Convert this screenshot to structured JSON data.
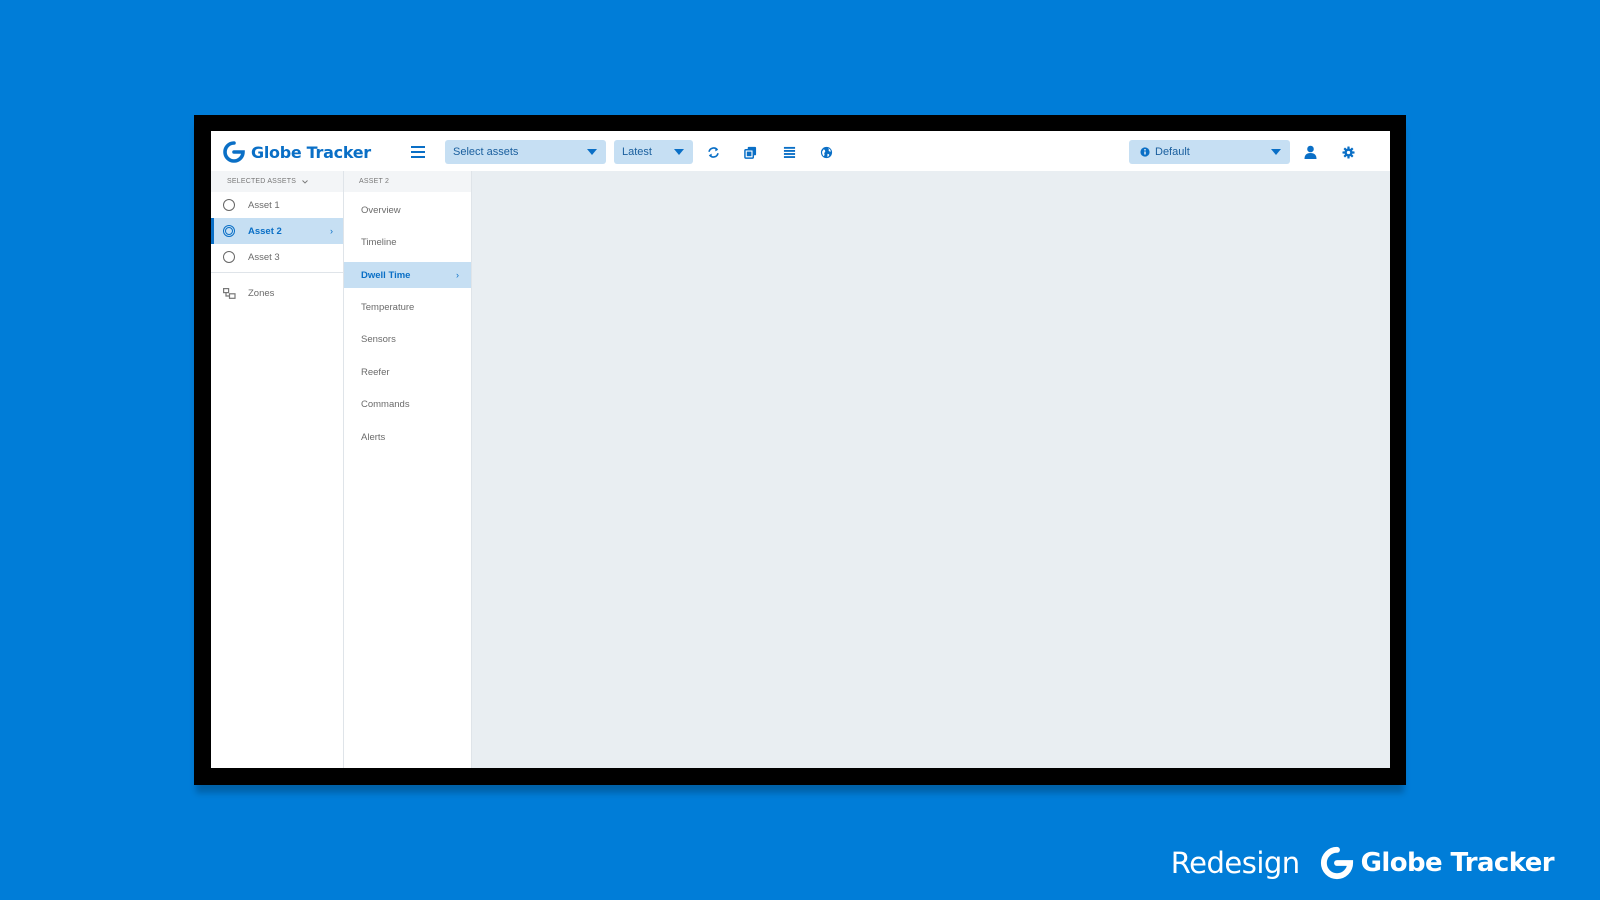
{
  "app": {
    "logo_text": "Globe Tracker",
    "brand_color": "#0a6fc6",
    "background_color": "#007dd8"
  },
  "toolbar": {
    "assets_dropdown": "Select assets",
    "time_dropdown": "Latest",
    "profile_dropdown": "Default",
    "icons": [
      "menu-icon",
      "refresh-icon",
      "copy-icon",
      "list-icon",
      "globe-icon",
      "user-icon",
      "gear-icon"
    ]
  },
  "sidebar": {
    "header": "SELECTED ASSETS",
    "assets": [
      {
        "label": "Asset 1",
        "active": false
      },
      {
        "label": "Asset 2",
        "active": true
      },
      {
        "label": "Asset 3",
        "active": false
      }
    ],
    "zones_label": "Zones"
  },
  "submenu": {
    "header": "ASSET 2",
    "items": [
      {
        "label": "Overview"
      },
      {
        "label": "Timeline"
      },
      {
        "label": "Dwell Time",
        "active": true
      },
      {
        "label": "Temperature"
      },
      {
        "label": "Sensors"
      },
      {
        "label": "Reefer"
      },
      {
        "label": "Commands"
      },
      {
        "label": "Alerts"
      }
    ]
  },
  "footer": {
    "redesign_label": "Redesign",
    "brand_text": "Globe Tracker"
  }
}
